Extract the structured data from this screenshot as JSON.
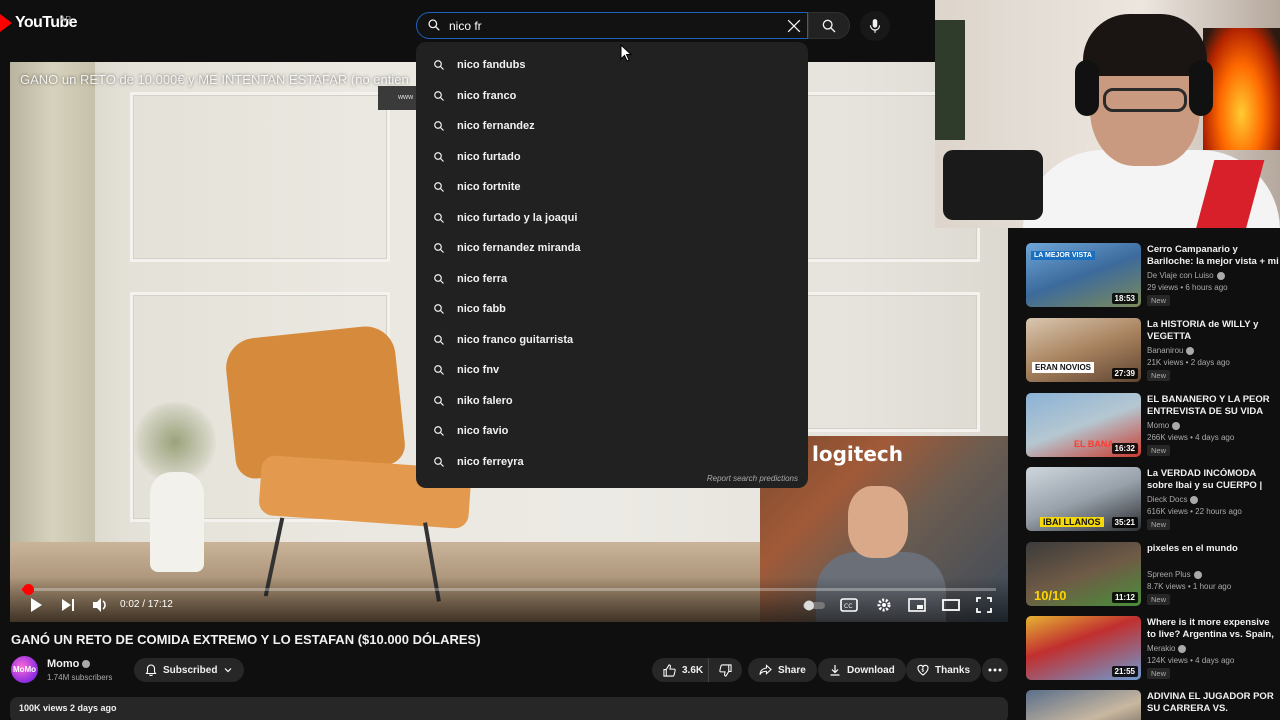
{
  "header": {
    "logo_text": "YouTube",
    "region": "AR",
    "search_value": "nico fr"
  },
  "suggestions": [
    "nico fandubs",
    "nico franco",
    "nico fernandez",
    "nico furtado",
    "nico fortnite",
    "nico furtado y la joaqui",
    "nico fernandez miranda",
    "nico ferra",
    "nico fabb",
    "nico franco guitarrista",
    "nico fnv",
    "niko falero",
    "nico favio",
    "nico ferreyra"
  ],
  "report_label": "Report search predictions",
  "player": {
    "overlay_title": "GANO un RETO de 10.000€ y ME INTENTAN ESTAFAR (no entien",
    "overlay_badge": "www",
    "pip_sign": "logitech",
    "time": "0:02 / 17:12",
    "progress": 0.002
  },
  "video": {
    "title": "GANÓ UN RETO DE COMIDA EXTREMO Y LO ESTAFAN ($10.000 DÓLARES)",
    "channel": "Momo",
    "subscribers": "1.74M subscribers",
    "subscribed_label": "Subscribed",
    "likes": "3.6K",
    "share_label": "Share",
    "download_label": "Download",
    "thanks_label": "Thanks",
    "views_date": "100K views  2 days ago",
    "avatar_text": "MoMo"
  },
  "recommendations": [
    {
      "title": "Cerro Campanario y Bariloche: la mejor vista + mi anécdota e...",
      "channel": "De Viaje con Luiso",
      "meta": "29 views • 6 hours ago",
      "badge": "New",
      "duration": "18:53",
      "thumb_text": "LA MEJOR VISTA"
    },
    {
      "title": "La HISTORIA de WILLY y VEGETTA",
      "channel": "Bananirou",
      "meta": "21K views • 2 days ago",
      "badge": "New",
      "duration": "27:39",
      "thumb_text": "ERAN NOVIOS"
    },
    {
      "title": "EL BANANERO Y LA PEOR ENTREVISTA DE SU VIDA",
      "channel": "Momo",
      "meta": "266K views • 4 days ago",
      "badge": "New",
      "duration": "16:32",
      "thumb_text": "EL BANA"
    },
    {
      "title": "La VERDAD INCÓMODA sobre Ibai y su CUERPO | Ibai Llanos",
      "channel": "Dieck Docs",
      "meta": "616K views • 22 hours ago",
      "badge": "New",
      "duration": "35:21",
      "thumb_text": "IBAI LLANOS"
    },
    {
      "title": "pixeles en el mundo",
      "channel": "Spreen Plus",
      "meta": "8.7K views • 1 hour ago",
      "badge": "New",
      "duration": "11:12",
      "thumb_text": "10/10"
    },
    {
      "title": "Where is it more expensive to live? Argentina vs. Spain, ...",
      "channel": "Merakio",
      "meta": "124K views • 4 days ago",
      "badge": "New",
      "duration": "21:55",
      "thumb_text": ""
    },
    {
      "title": "ADIVINA EL JUGADOR POR SU CARRERA VS. LISANDRO ...",
      "channel": "",
      "meta": "",
      "badge": "",
      "duration": "",
      "thumb_text": ""
    }
  ],
  "colors": {
    "accent_red": "#ff0000",
    "focus_blue": "#1c62b9",
    "bg": "#0f0f0f",
    "pill": "#272727"
  }
}
